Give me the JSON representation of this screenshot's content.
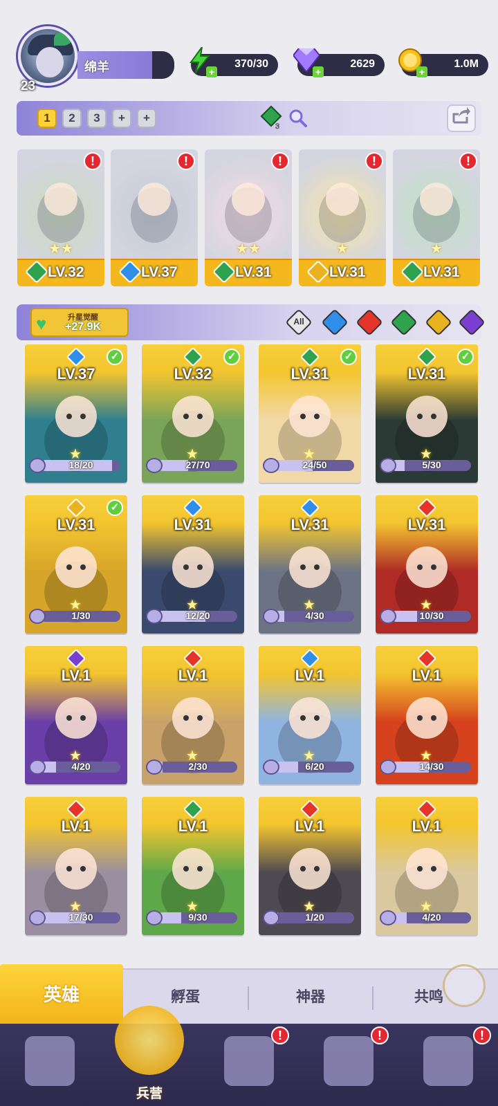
{
  "player": {
    "level": "23",
    "name": "绵羊"
  },
  "resources": [
    {
      "name": "energy",
      "icon": "lightning-icon",
      "value": "370/30",
      "color": "#47d43a"
    },
    {
      "name": "gems",
      "icon": "diamond-icon",
      "value": "2629",
      "color": "#a07bff"
    },
    {
      "name": "coins",
      "icon": "coin-icon",
      "value": "1.0M",
      "color": "#f5c21b"
    }
  ],
  "team_tabs": [
    "1",
    "2",
    "3",
    "+",
    "+"
  ],
  "team_gem_count": "3",
  "team": [
    {
      "level": "LV.32",
      "element": "nature",
      "stars": "★★"
    },
    {
      "level": "LV.37",
      "element": "water",
      "stars": ""
    },
    {
      "level": "LV.31",
      "element": "nature",
      "stars": "★★"
    },
    {
      "level": "LV.31",
      "element": "light",
      "stars": "★"
    },
    {
      "level": "LV.31",
      "element": "nature",
      "stars": "★"
    }
  ],
  "awaken": {
    "label": "升星觉醒",
    "value": "+27.9K"
  },
  "filters": [
    "All",
    "water",
    "fire",
    "nature",
    "light",
    "dark"
  ],
  "element_colors": {
    "water": "#2f8fe8",
    "fire": "#e5352a",
    "nature": "#2ea24c",
    "light": "#e9b320",
    "dark": "#7a3fd0"
  },
  "heroes": [
    {
      "level": "LV.37",
      "element": "water",
      "progress": "18/20",
      "ratio": 0.9,
      "check": true,
      "bg": "#2f7f8f"
    },
    {
      "level": "LV.32",
      "element": "nature",
      "progress": "27/70",
      "ratio": 0.39,
      "check": true,
      "bg": "#7aa45a"
    },
    {
      "level": "LV.31",
      "element": "nature",
      "progress": "24/50",
      "ratio": 0.48,
      "check": true,
      "bg": "#f2d9a8"
    },
    {
      "level": "LV.31",
      "element": "nature",
      "progress": "5/30",
      "ratio": 0.17,
      "check": true,
      "bg": "#2b3a34"
    },
    {
      "level": "LV.31",
      "element": "light",
      "progress": "1/30",
      "ratio": 0.03,
      "check": true,
      "bg": "#d6a52a"
    },
    {
      "level": "LV.31",
      "element": "water",
      "progress": "12/20",
      "ratio": 0.6,
      "check": false,
      "bg": "#3a4a6e"
    },
    {
      "level": "LV.31",
      "element": "water",
      "progress": "4/30",
      "ratio": 0.13,
      "check": false,
      "bg": "#6c7384"
    },
    {
      "level": "LV.31",
      "element": "fire",
      "progress": "10/30",
      "ratio": 0.33,
      "check": false,
      "bg": "#b02a26"
    },
    {
      "level": "LV.1",
      "element": "dark",
      "progress": "4/20",
      "ratio": 0.2,
      "check": false,
      "bg": "#6b3fa8"
    },
    {
      "level": "LV.1",
      "element": "fire",
      "progress": "2/30",
      "ratio": 0.07,
      "check": false,
      "bg": "#c9a26a"
    },
    {
      "level": "LV.1",
      "element": "water",
      "progress": "6/20",
      "ratio": 0.3,
      "check": false,
      "bg": "#8fb4e0"
    },
    {
      "level": "LV.1",
      "element": "fire",
      "progress": "14/30",
      "ratio": 0.47,
      "check": false,
      "bg": "#d6421e"
    },
    {
      "level": "LV.1",
      "element": "fire",
      "progress": "17/30",
      "ratio": 0.57,
      "check": false,
      "bg": "#9a8ea0"
    },
    {
      "level": "LV.1",
      "element": "nature",
      "progress": "9/30",
      "ratio": 0.3,
      "check": false,
      "bg": "#5ea84a"
    },
    {
      "level": "LV.1",
      "element": "fire",
      "progress": "1/20",
      "ratio": 0.05,
      "check": false,
      "bg": "#4e4a52"
    },
    {
      "level": "LV.1",
      "element": "fire",
      "progress": "4/20",
      "ratio": 0.2,
      "check": false,
      "bg": "#d9c8a0"
    }
  ],
  "sub_tabs": [
    "英雄",
    "孵蛋",
    "神器",
    "共鸣"
  ],
  "nav": [
    {
      "label": "",
      "icon": "cards-icon",
      "alert": false
    },
    {
      "label": "兵营",
      "icon": "barracks-icon",
      "alert": false
    },
    {
      "label": "",
      "icon": "map-icon",
      "alert": true
    },
    {
      "label": "",
      "icon": "shrine-icon",
      "alert": true
    },
    {
      "label": "",
      "icon": "guild-icon",
      "alert": true
    }
  ]
}
